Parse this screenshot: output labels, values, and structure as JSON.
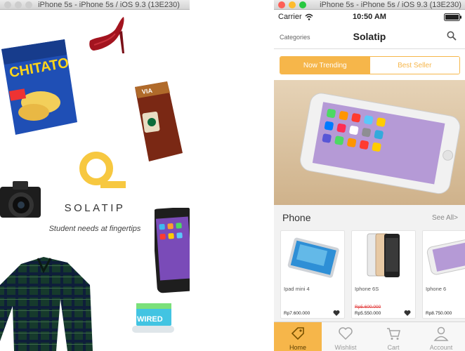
{
  "window": {
    "title": "iPhone 5s - iPhone 5s / iOS 9.3 (13E230)",
    "traffic_colors": {
      "close": "#fd5f57",
      "minimize": "#fdbb2e",
      "maximize": "#28c840",
      "inactive": "#cdcdcd"
    }
  },
  "splash": {
    "brand_name": "SOLATIP",
    "tagline": "Student needs at fingertips",
    "logo_color": "#f7c840",
    "chips_text": "CHITATO",
    "coffee_text": "VIA",
    "toothbrush_text": "WIRED"
  },
  "status": {
    "carrier": "Carrier",
    "time": "10:50 AM"
  },
  "nav": {
    "left": "Categories",
    "title": "Solatip"
  },
  "segment": {
    "trending": "Now Trending",
    "best": "Best Seller",
    "accent": "#f6b64a"
  },
  "section": {
    "title": "Phone",
    "see_all": "See All>"
  },
  "products": [
    {
      "name": "Ipad mini 4",
      "old_price": "",
      "price": "Rp7.600.000"
    },
    {
      "name": "Iphone 6S",
      "old_price": "Rp5.600.000",
      "price": "Rp5.550.000"
    },
    {
      "name": "Iphone 6",
      "old_price": "",
      "price": "Rp8.750.000"
    }
  ],
  "tabs": [
    {
      "label": "Home",
      "icon": "tag-icon"
    },
    {
      "label": "Wishlist",
      "icon": "heart-icon"
    },
    {
      "label": "Cart",
      "icon": "cart-icon"
    },
    {
      "label": "Account",
      "icon": "user-icon"
    }
  ]
}
